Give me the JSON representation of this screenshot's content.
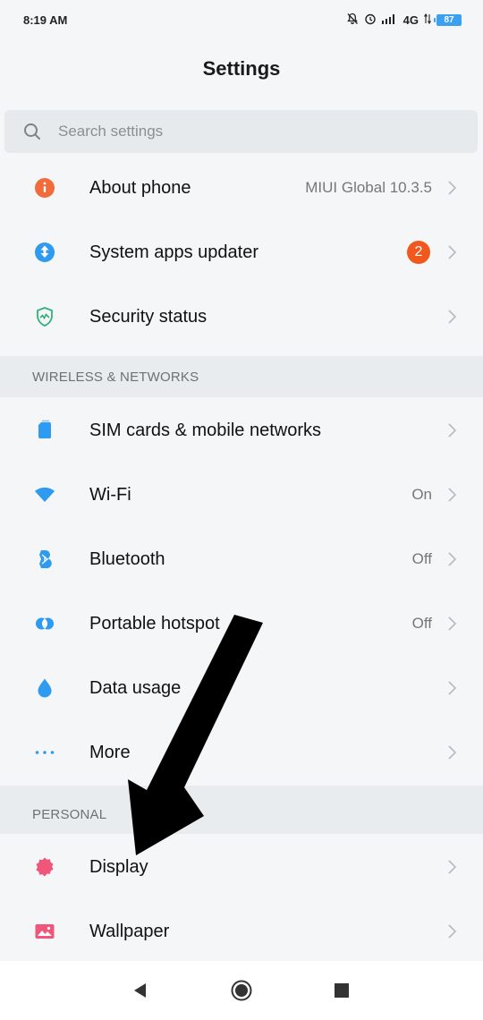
{
  "status_bar": {
    "time": "8:19 AM",
    "network": "4G",
    "battery": "87"
  },
  "header": {
    "title": "Settings"
  },
  "search": {
    "placeholder": "Search settings"
  },
  "rows_top": [
    {
      "label": "About phone",
      "value": "MIUI Global 10.3.5",
      "icon": "info-icon",
      "color": "#f26b3a"
    },
    {
      "label": "System apps updater",
      "badge": "2",
      "icon": "update-arrow-icon",
      "color": "#2f9bf0"
    },
    {
      "label": "Security status",
      "icon": "shield-icon",
      "color": "#33b07a"
    }
  ],
  "sections": {
    "wireless": "WIRELESS & NETWORKS",
    "personal": "PERSONAL"
  },
  "rows_wireless": [
    {
      "label": "SIM cards & mobile networks",
      "icon": "sim-card-icon",
      "color": "#2f9bf0"
    },
    {
      "label": "Wi-Fi",
      "value": "On",
      "icon": "wifi-icon",
      "color": "#2f9bf0"
    },
    {
      "label": "Bluetooth",
      "value": "Off",
      "icon": "bluetooth-icon",
      "color": "#2f9bf0"
    },
    {
      "label": "Portable hotspot",
      "value": "Off",
      "icon": "hotspot-icon",
      "color": "#2f9bf0"
    },
    {
      "label": "Data usage",
      "icon": "water-drop-icon",
      "color": "#2f9bf0"
    },
    {
      "label": "More",
      "icon": "more-dots-icon",
      "color": "#2f9bf0"
    }
  ],
  "rows_personal": [
    {
      "label": "Display",
      "icon": "display-icon",
      "color": "#f0567a"
    },
    {
      "label": "Wallpaper",
      "icon": "wallpaper-icon",
      "color": "#f0567a"
    }
  ],
  "nav": {
    "back": "back-icon",
    "home": "home-icon",
    "recents": "recents-icon"
  },
  "colors": {
    "background": "#f4f6f7",
    "section_bg": "#e8ecee",
    "badge": "#f0581e",
    "accent_blue": "#2f9bf0"
  }
}
